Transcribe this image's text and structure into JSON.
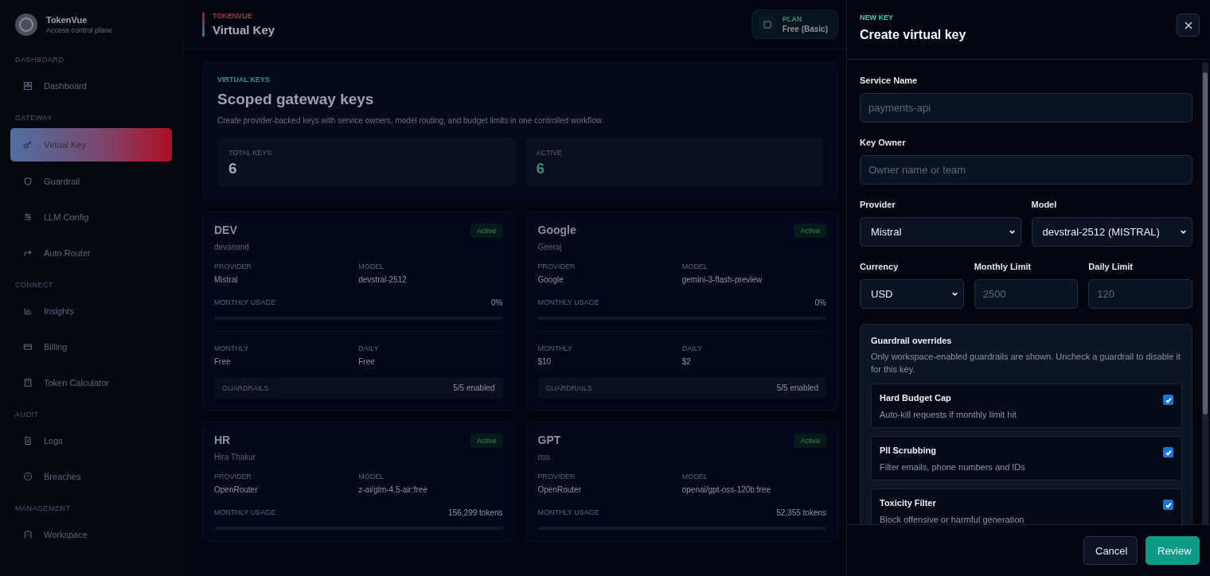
{
  "sidebar": {
    "brand": {
      "name": "TokenVue",
      "subtitle": "Access control plane"
    },
    "sections": [
      {
        "title": "DASHBOARD",
        "items": [
          {
            "label": "Dashboard",
            "selected": false
          }
        ]
      },
      {
        "title": "GATEWAY",
        "items": [
          {
            "label": "Virtual Key",
            "selected": true
          },
          {
            "label": "Guardrail",
            "selected": false
          },
          {
            "label": "LLM Config",
            "selected": false
          },
          {
            "label": "Auto Router",
            "selected": false
          }
        ]
      },
      {
        "title": "CONNECT",
        "items": [
          {
            "label": "Insights",
            "selected": false
          },
          {
            "label": "Billing",
            "selected": false
          },
          {
            "label": "Token Calculator",
            "selected": false
          }
        ]
      },
      {
        "title": "AUDIT",
        "items": [
          {
            "label": "Logs",
            "selected": false
          },
          {
            "label": "Breaches",
            "selected": false
          }
        ]
      },
      {
        "title": "MANAGEMENT",
        "items": [
          {
            "label": "Workspace",
            "selected": false
          }
        ]
      }
    ]
  },
  "header": {
    "eyebrow": "TOKENVUE",
    "title": "Virtual Key",
    "plan": {
      "label": "PLAN",
      "value": "Free (Basic)"
    }
  },
  "overview": {
    "eyebrow": "VIRTUAL KEYS",
    "title": "Scoped gateway keys",
    "description": "Create provider-backed keys with service owners, model routing, and budget limits in one controlled workflow.",
    "stats": [
      {
        "label": "TOTAL KEYS",
        "value": "6",
        "kind": "total"
      },
      {
        "label": "ACTIVE",
        "value": "6",
        "kind": "active"
      }
    ]
  },
  "keys": [
    {
      "name": "DEV",
      "owner": "devanand",
      "status": "Active",
      "provider_label": "PROVIDER",
      "provider": "Mistral",
      "model_label": "MODEL",
      "model": "devstral-2512",
      "usage_label": "MONTHLY USAGE",
      "usage": "0%",
      "limits": [
        {
          "label": "MONTHLY",
          "value": "Free"
        },
        {
          "label": "DAILY",
          "value": "Free"
        }
      ],
      "guardrails_label": "GUARDRAILS",
      "guardrails": "5/5 enabled"
    },
    {
      "name": "Google",
      "owner": "Geeraj",
      "status": "Active",
      "provider_label": "PROVIDER",
      "provider": "Google",
      "model_label": "MODEL",
      "model": "gemini-3-flash-preview",
      "usage_label": "MONTHLY USAGE",
      "usage": "0%",
      "limits": [
        {
          "label": "MONTHLY",
          "value": "$10"
        },
        {
          "label": "DAILY",
          "value": "$2"
        }
      ],
      "guardrails_label": "GUARDRAILS",
      "guardrails": "5/5 enabled"
    },
    {
      "name": "HR",
      "owner": "Hira Thakur",
      "status": "Active",
      "provider_label": "PROVIDER",
      "provider": "OpenRouter",
      "model_label": "MODEL",
      "model": "z-ai/glm-4.5-air:free",
      "usage_label": "MONTHLY USAGE",
      "usage": "156,299 tokens"
    },
    {
      "name": "GPT",
      "owner": "oss",
      "status": "Active",
      "provider_label": "PROVIDER",
      "provider": "OpenRouter",
      "model_label": "MODEL",
      "model": "openai/gpt-oss-120b:free",
      "usage_label": "MONTHLY USAGE",
      "usage": "52,355 tokens"
    }
  ],
  "drawer": {
    "eyebrow": "NEW KEY",
    "title": "Create virtual key",
    "service_name": {
      "label": "Service Name",
      "placeholder": "payments-api"
    },
    "key_owner": {
      "label": "Key Owner",
      "placeholder": "Owner name or team"
    },
    "provider": {
      "label": "Provider",
      "value": "Mistral"
    },
    "model": {
      "label": "Model",
      "value": "devstral-2512 (MISTRAL)"
    },
    "currency": {
      "label": "Currency",
      "value": "USD"
    },
    "monthly_limit": {
      "label": "Monthly Limit",
      "placeholder": "2500"
    },
    "daily_limit": {
      "label": "Daily Limit",
      "placeholder": "120"
    },
    "guardrails": {
      "title": "Guardrail overrides",
      "description": "Only workspace-enabled guardrails are shown. Uncheck a guardrail to disable it for this key.",
      "items": [
        {
          "name": "Hard Budget Cap",
          "description": "Auto-kill requests if monthly limit hit",
          "checked": true
        },
        {
          "name": "PII Scrubbing",
          "description": "Filter emails, phone numbers and IDs",
          "checked": true
        },
        {
          "name": "Toxicity Filter",
          "description": "Block offensive or harmful generation",
          "checked": true
        }
      ]
    },
    "buttons": {
      "cancel": "Cancel",
      "review": "Review"
    }
  }
}
